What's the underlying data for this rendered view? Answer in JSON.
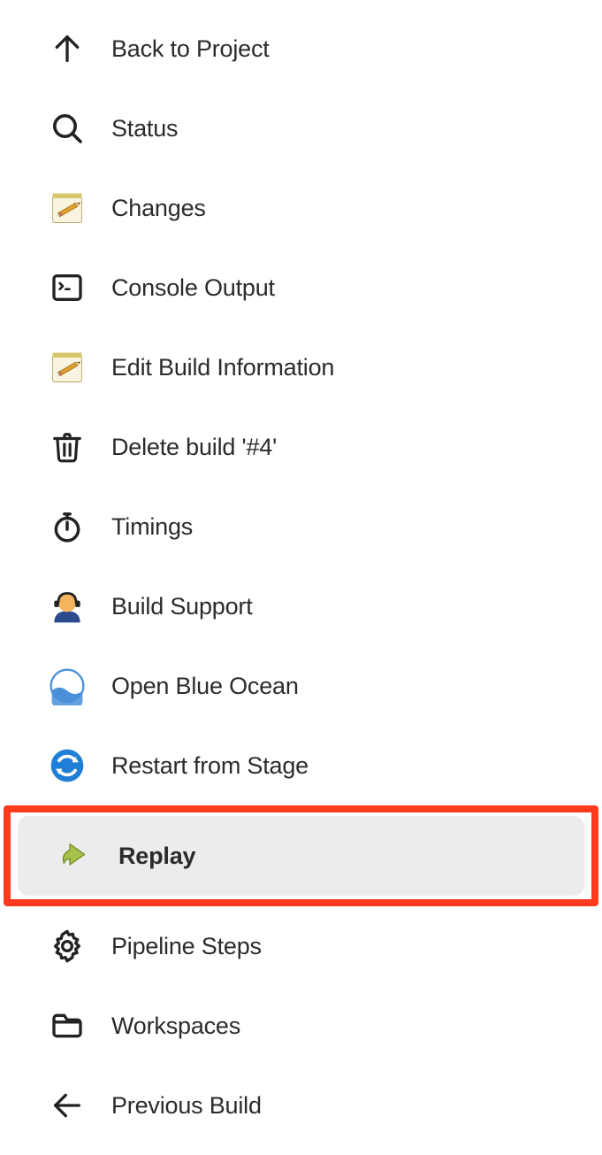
{
  "menu": {
    "items": [
      {
        "label": "Back to Project"
      },
      {
        "label": "Status"
      },
      {
        "label": "Changes"
      },
      {
        "label": "Console Output"
      },
      {
        "label": "Edit Build Information"
      },
      {
        "label": "Delete build '#4'"
      },
      {
        "label": "Timings"
      },
      {
        "label": "Build Support"
      },
      {
        "label": "Open Blue Ocean"
      },
      {
        "label": "Restart from Stage"
      },
      {
        "label": "Replay"
      },
      {
        "label": "Pipeline Steps"
      },
      {
        "label": "Workspaces"
      },
      {
        "label": "Previous Build"
      }
    ],
    "highlighted_index": 10
  }
}
